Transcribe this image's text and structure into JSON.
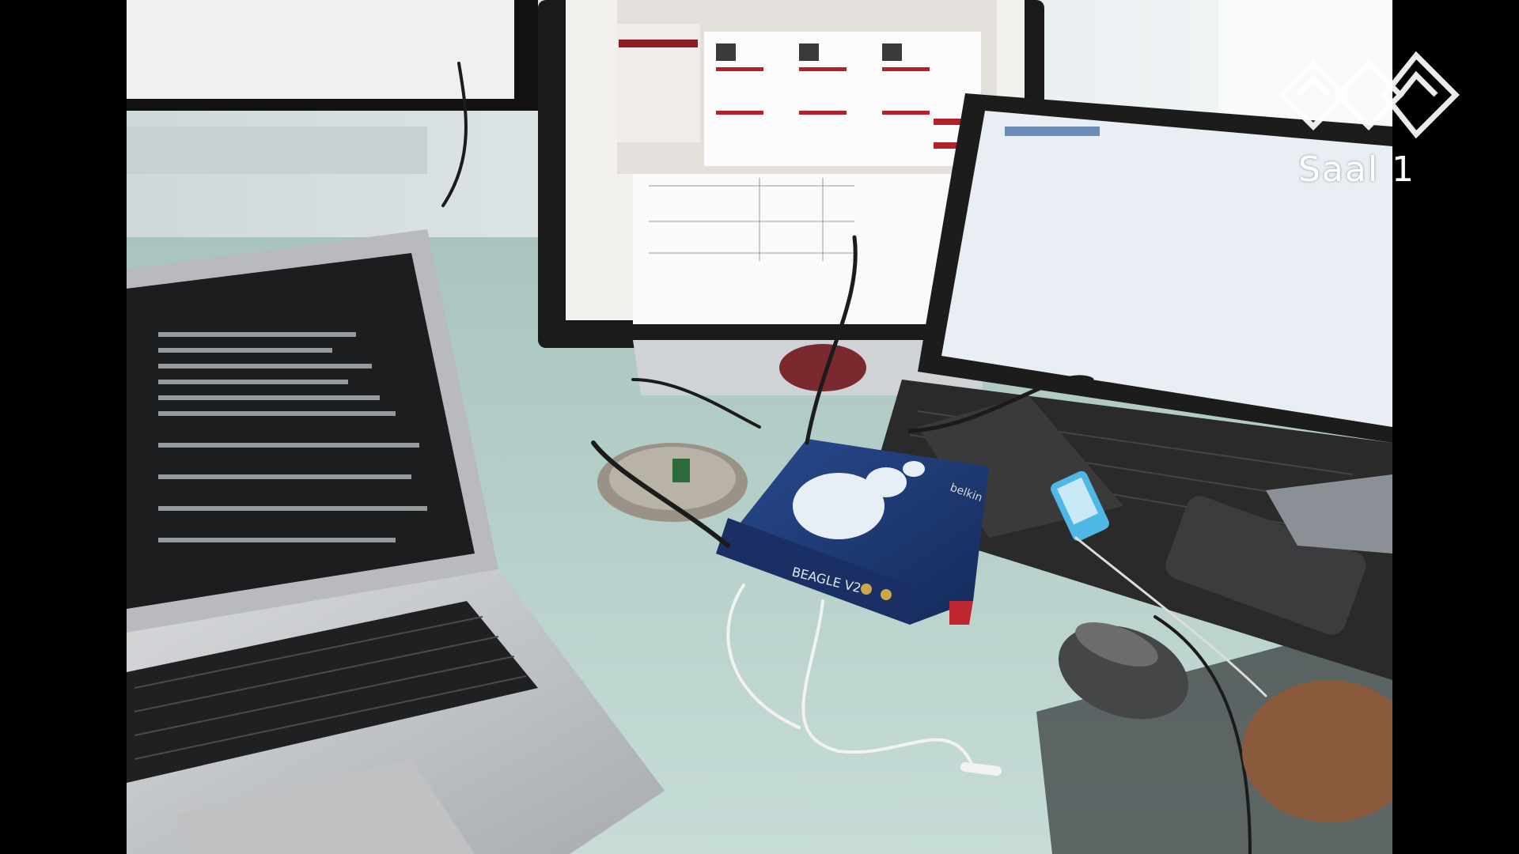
{
  "stream": {
    "channel_logo": {
      "icon": "ccc-logo-icon",
      "label": "Saal 1"
    }
  },
  "photo": {
    "subject": "desk with usb protocol analyzer, monitor, two laptops and accessories",
    "device_label": "BEAGLE V2",
    "mat_label": "belkin",
    "colors": {
      "desk": "#b9cfc9",
      "analyzer": "#1f3a78",
      "monitor_bezel": "#1a1a1a",
      "macbook": "#c4c6c8"
    }
  }
}
